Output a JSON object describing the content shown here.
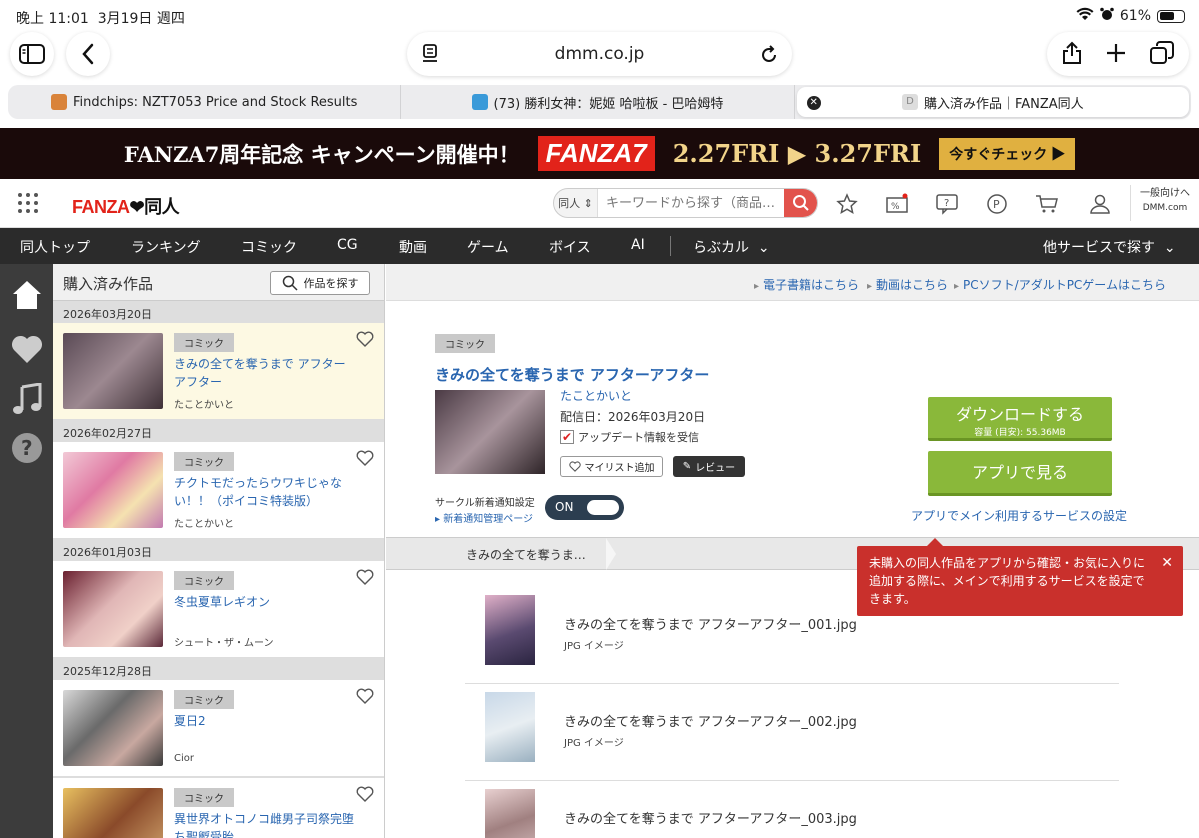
{
  "status": {
    "time": "晚上 11:01",
    "date": "3月19日 週四",
    "battery": "61%"
  },
  "browser": {
    "url": "dmm.co.jp",
    "tabs": [
      {
        "label": "Findchips: NZT7053 Price and Stock Results",
        "favicon_color": "#d9833a"
      },
      {
        "label": "(73) 勝利女神：妮姬 哈啦板 - 巴哈姆特",
        "favicon_color": "#3a9ad9"
      },
      {
        "label": "購入済み作品｜FANZA同人",
        "favicon_color": "#cccccc"
      }
    ]
  },
  "banner": {
    "text": "FANZA7周年記念 キャンペーン開催中！",
    "logo": "FANZA7",
    "dates": "2.27FRI ▶ 3.27FRI",
    "cta": "今すぐチェック ▶"
  },
  "header": {
    "logo_main": "FANZA",
    "logo_sub": "同人",
    "search_category": "同人",
    "search_placeholder": "キーワードから探す（商品…",
    "general_line1": "一般向けへ",
    "general_line2": "DMM.com"
  },
  "nav": {
    "items": [
      "同人トップ",
      "ランキング",
      "コミック",
      "CG",
      "動画",
      "ゲーム",
      "ボイス",
      "AI",
      "らぶカル"
    ],
    "other": "他サービスで探す"
  },
  "purchased": {
    "title": "購入済み作品",
    "find_button": "作品を探す",
    "groups": [
      {
        "date": "2026年03月20日",
        "badge": "コミック",
        "title": "きみの全てを奪うまで アフターアフター",
        "author": "たことかいと",
        "color": "#6b5a66"
      },
      {
        "date": "2026年02月27日",
        "badge": "コミック",
        "title": "チクトモだったらウワキじゃない！！（ポイコミ特装版）",
        "author": "たことかいと",
        "color": "#e6a9c2"
      },
      {
        "date": "2026年01月03日",
        "badge": "コミック",
        "title": "冬虫夏草レギオン",
        "author": "シュート・ザ・ムーン",
        "color": "#c99a9a"
      },
      {
        "date": "2025年12月28日",
        "badge": "コミック",
        "title": "夏日2",
        "author": "Cior",
        "color": "#8a8a8a"
      },
      {
        "date": "",
        "badge": "コミック",
        "title": "異世界オトコノコ雌男子司祭完堕ち聖孵受胎",
        "author": "",
        "color": "#b8874a"
      }
    ]
  },
  "links": [
    "電子書籍はこちら",
    "動画はこちら",
    "PCソフト/アダルトPCゲームはこちら"
  ],
  "detail": {
    "badge": "コミック",
    "title": "きみの全てを奪うまで アフターアフター",
    "author": "たことかいと",
    "delivery": "配信日：2026年03月20日",
    "update_check": "アップデート情報を受信",
    "mylist": "マイリスト追加",
    "review": "レビュー",
    "notify_label": "サークル新着通知設定",
    "notify_link": "新着通知管理ページ",
    "toggle": "ON",
    "download": "ダウンロードする",
    "download_sub": "容量 (目安): 55.36MB",
    "app_button": "アプリで見る",
    "app_settings": "アプリでメイン利用するサービスの設定",
    "crumb": "きみの全てを奪うま…"
  },
  "tooltip": {
    "text": "未購入の同人作品をアプリから確認・お気に入りに追加する際に、メインで利用するサービスを設定できます。",
    "close": "✕"
  },
  "files": [
    {
      "name": "きみの全てを奪うまで アフターアフター_001.jpg",
      "type": "JPG イメージ",
      "color": "#8a6b8a"
    },
    {
      "name": "きみの全てを奪うまで アフターアフター_002.jpg",
      "type": "JPG イメージ",
      "color": "#b8c8d8"
    },
    {
      "name": "きみの全てを奪うまで アフターアフター_003.jpg",
      "type": "",
      "color": "#c8b0b0"
    }
  ]
}
